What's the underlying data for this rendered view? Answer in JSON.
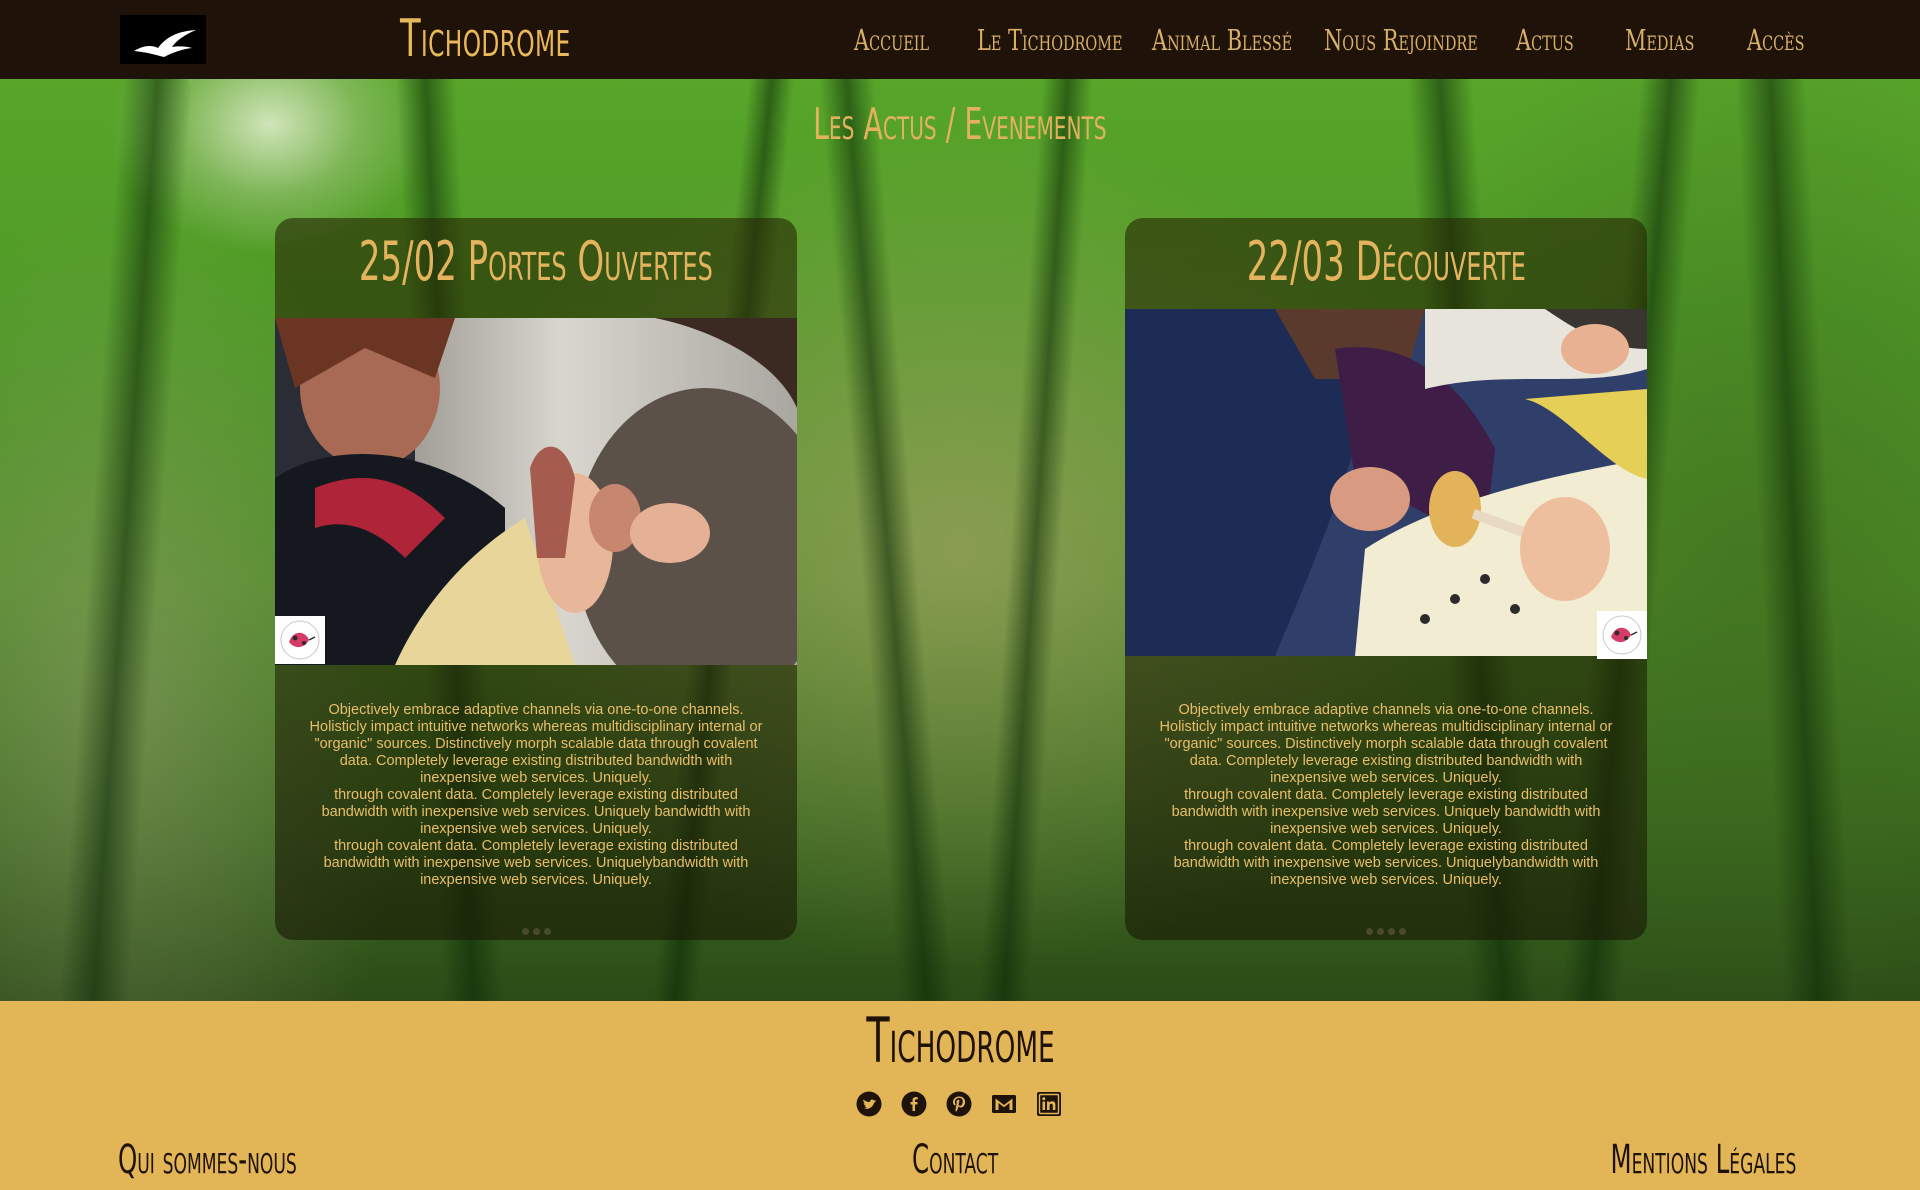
{
  "header": {
    "site_title": "Tichodrome",
    "logo_icon": "seagull-logo-icon",
    "nav": [
      {
        "label": "Accueil"
      },
      {
        "label": "Le Tichodrome"
      },
      {
        "label": "Animal Blessé"
      },
      {
        "label": "Nous Rejoindre"
      },
      {
        "label": "Actus"
      },
      {
        "label": "Medias"
      },
      {
        "label": "Accès"
      }
    ]
  },
  "main": {
    "section_title": "Les Actus / Evenements",
    "cards": [
      {
        "title": "25/02 Portes Ouvertes",
        "paragraphs": [
          "Objectively embrace adaptive channels via one-to-one channels. Holisticly impact intuitive networks whereas multidisciplinary internal or \"organic\" sources. Distinctively morph scalable data through covalent data. Completely leverage existing distributed bandwidth with inexpensive web services. Uniquely.",
          "through covalent data. Completely leverage existing distributed bandwidth with inexpensive web services. Uniquely bandwidth with inexpensive web services. Uniquely.",
          "through covalent data. Completely leverage existing distributed bandwidth with inexpensive web services. Uniquelybandwidth with inexpensive web services. Uniquely."
        ],
        "slide_count": 3
      },
      {
        "title": "22/03 Découverte",
        "paragraphs": [
          "Objectively embrace adaptive channels via one-to-one channels. Holisticly impact intuitive networks whereas multidisciplinary internal or \"organic\" sources. Distinctively morph scalable data through covalent data. Completely leverage existing distributed bandwidth with inexpensive web services. Uniquely.",
          "through covalent data. Completely leverage existing distributed bandwidth with inexpensive web services. Uniquely bandwidth with inexpensive web services. Uniquely.",
          "through covalent data. Completely leverage existing distributed bandwidth with inexpensive web services. Uniquelybandwidth with inexpensive web services. Uniquely."
        ],
        "slide_count": 4
      }
    ]
  },
  "footer": {
    "title": "Tichodrome",
    "socials": [
      "twitter-icon",
      "facebook-icon",
      "pinterest-icon",
      "gmail-icon",
      "linkedin-icon"
    ],
    "links": [
      {
        "label": "Qui sommes-nous"
      },
      {
        "label": "Contact"
      },
      {
        "label": "Mentions Légales"
      }
    ]
  },
  "colors": {
    "header_bg": "#1f1209",
    "accent": "#e2b25e",
    "footer_bg": "#e2b556",
    "card_text": "#e8be6a"
  }
}
